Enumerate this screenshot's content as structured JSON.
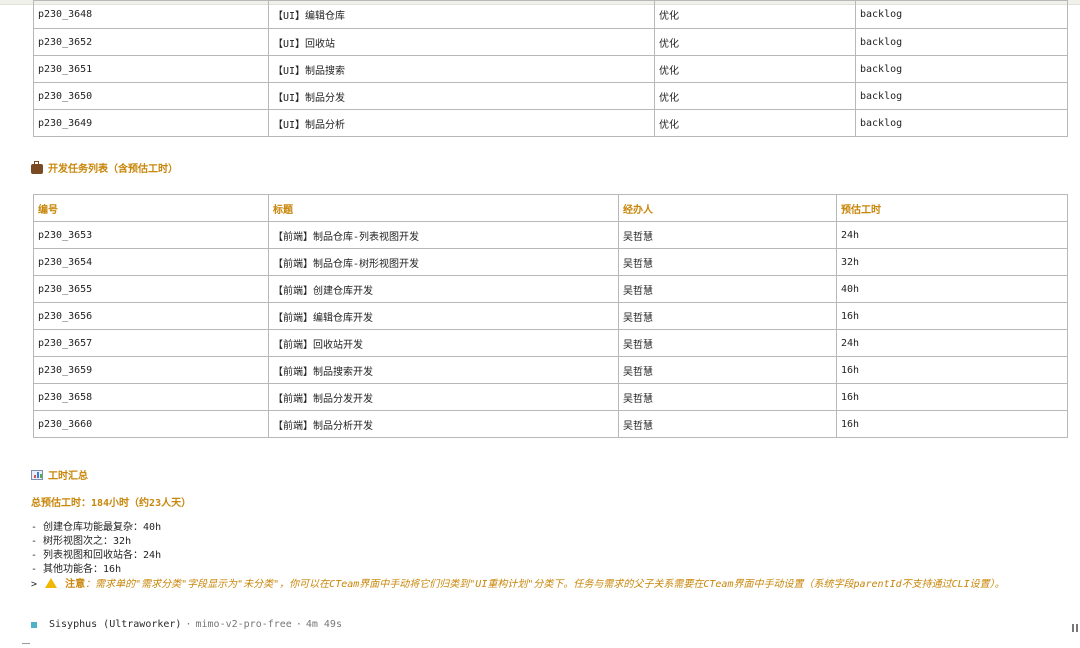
{
  "top_table": {
    "rows": [
      {
        "id": "p230_3648",
        "title": "【UI】编辑仓库",
        "type": "优化",
        "status": "backlog"
      },
      {
        "id": "p230_3652",
        "title": "【UI】回收站",
        "type": "优化",
        "status": "backlog"
      },
      {
        "id": "p230_3651",
        "title": "【UI】制品搜索",
        "type": "优化",
        "status": "backlog"
      },
      {
        "id": "p230_3650",
        "title": "【UI】制品分发",
        "type": "优化",
        "status": "backlog"
      },
      {
        "id": "p230_3649",
        "title": "【UI】制品分析",
        "type": "优化",
        "status": "backlog"
      }
    ]
  },
  "dev_section": {
    "icon": "briefcase-icon",
    "title": "开发任务列表（含预估工时）",
    "headers": [
      "编号",
      "标题",
      "经办人",
      "预估工时"
    ],
    "rows": [
      {
        "id": "p230_3653",
        "title": "【前端】制品仓库-列表视图开发",
        "assignee": "吴哲慧",
        "estimate": "24h"
      },
      {
        "id": "p230_3654",
        "title": "【前端】制品仓库-树形视图开发",
        "assignee": "吴哲慧",
        "estimate": "32h"
      },
      {
        "id": "p230_3655",
        "title": "【前端】创建仓库开发",
        "assignee": "吴哲慧",
        "estimate": "40h"
      },
      {
        "id": "p230_3656",
        "title": "【前端】编辑仓库开发",
        "assignee": "吴哲慧",
        "estimate": "16h"
      },
      {
        "id": "p230_3657",
        "title": "【前端】回收站开发",
        "assignee": "吴哲慧",
        "estimate": "24h"
      },
      {
        "id": "p230_3659",
        "title": "【前端】制品搜索开发",
        "assignee": "吴哲慧",
        "estimate": "16h"
      },
      {
        "id": "p230_3658",
        "title": "【前端】制品分发开发",
        "assignee": "吴哲慧",
        "estimate": "16h"
      },
      {
        "id": "p230_3660",
        "title": "【前端】制品分析开发",
        "assignee": "吴哲慧",
        "estimate": "16h"
      }
    ]
  },
  "summary": {
    "icon": "bar-chart-icon",
    "title": "工时汇总",
    "total": "总预估工时：184小时（约23人天）",
    "items": [
      "- 创建仓库功能最复杂：40h",
      "- 树形视图次之：32h",
      "- 列表视图和回收站各：24h",
      "- 其他功能各：16h"
    ],
    "note_prefix": ">",
    "note_label": "注意",
    "note_text": "：需求单的\"需求分类\"字段显示为\"未分类\"，你可以在CTeam界面中手动将它们归类到\"UI重构计划\"分类下。任务与需求的父子关系需要在CTeam界面中手动设置（系统字段parentId不支持通过CLI设置）。"
  },
  "status_bar": {
    "agent": "Sisyphus (Ultraworker)",
    "separator1": "·",
    "model": "mimo-v2-pro-free",
    "separator2": "·",
    "duration": "4m 49s"
  },
  "colors": {
    "accent": "#c8860a",
    "border": "#b8b8b8",
    "status_square": "#4fb3c8"
  }
}
